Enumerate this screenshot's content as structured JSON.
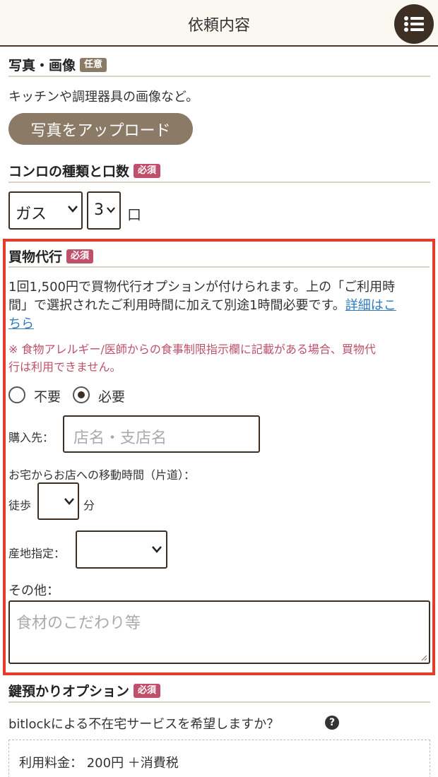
{
  "header": {
    "title": "依頼内容",
    "menu_icon": "list-icon"
  },
  "photo": {
    "title": "写真・画像",
    "tag": "任意",
    "desc": "キッチンや調理器具の画像など。",
    "upload_label": "写真をアップロード"
  },
  "stove": {
    "title": "コンロの種類と口数",
    "tag": "必須",
    "type_value": "ガス",
    "count_value": "3",
    "unit": "口"
  },
  "shopping": {
    "title": "買物代行",
    "tag": "必須",
    "desc_line1": "1回1,500円で買物代行オプションが付けられます。上の「ご利用時",
    "desc_line2_prefix": "間」で選択されたご利用時間に加えて別途1時間必要です。",
    "link_text_a": "詳細はこ",
    "link_text_b": "ちら",
    "warning_line1": "※ 食物アレルギー/医師からの食事制限指示欄に記載がある場合、買物代",
    "warning_line2": "行は利用できません。",
    "radio_no": "不要",
    "radio_yes": "必要",
    "selected": "必要",
    "store_label": "購入先：",
    "store_placeholder": "店名・支店名",
    "travel_label": "お宅からお店への移動時間（片道）：",
    "walk_label": "徒歩",
    "minutes_label": "分",
    "origin_label": "産地指定：",
    "other_label": "その他：",
    "other_placeholder": "食材のこだわり等"
  },
  "key": {
    "title": "鍵預かりオプション",
    "tag": "必須",
    "question": "bitlockによる不在宅サービスを希望しますか？",
    "fee_text": "利用料金：  200円 ＋消費税"
  },
  "colors": {
    "brand_dark": "#3d2f24",
    "tag_optional": "#8a7a66",
    "tag_required": "#c0506a",
    "highlight": "#e53b2d",
    "link": "#2f7bbd"
  }
}
